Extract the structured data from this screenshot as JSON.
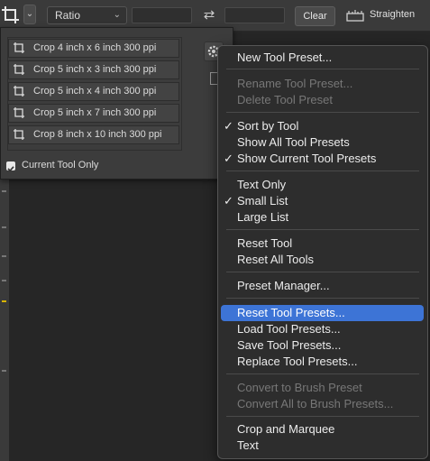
{
  "options_bar": {
    "ratio_value": "Ratio",
    "clear_label": "Clear",
    "straighten_label": "Straighten",
    "icons": [
      "crop-icon",
      "chevron-down-icon",
      "swap-icon",
      "straighten-icon"
    ]
  },
  "presets_panel": {
    "items": [
      {
        "label": "Crop 4 inch x 6 inch 300 ppi"
      },
      {
        "label": "Crop 5 inch x 3 inch 300 ppi"
      },
      {
        "label": "Crop 5 inch x 4 inch 300 ppi"
      },
      {
        "label": "Crop 5 inch x 7 inch 300 ppi"
      },
      {
        "label": "Crop 8 inch x 10 inch 300 ppi"
      }
    ],
    "current_tool_only_label": "Current Tool Only",
    "current_tool_only_checked": true
  },
  "menu": {
    "items": [
      {
        "label": "New Tool Preset...",
        "enabled": true,
        "checked": false
      },
      {
        "label": "Rename Tool Preset...",
        "enabled": false,
        "checked": false
      },
      {
        "label": "Delete Tool Preset",
        "enabled": false,
        "checked": false
      },
      {
        "label": "Sort by Tool",
        "enabled": true,
        "checked": true
      },
      {
        "label": "Show All Tool Presets",
        "enabled": true,
        "checked": false
      },
      {
        "label": "Show Current Tool Presets",
        "enabled": true,
        "checked": true
      },
      {
        "label": "Text Only",
        "enabled": true,
        "checked": false
      },
      {
        "label": "Small List",
        "enabled": true,
        "checked": true
      },
      {
        "label": "Large List",
        "enabled": true,
        "checked": false
      },
      {
        "label": "Reset Tool",
        "enabled": true,
        "checked": false
      },
      {
        "label": "Reset All Tools",
        "enabled": true,
        "checked": false
      },
      {
        "label": "Preset Manager...",
        "enabled": true,
        "checked": false
      },
      {
        "label": "Reset Tool Presets...",
        "enabled": true,
        "checked": false,
        "highlighted": true
      },
      {
        "label": "Load Tool Presets...",
        "enabled": true,
        "checked": false
      },
      {
        "label": "Save Tool Presets...",
        "enabled": true,
        "checked": false
      },
      {
        "label": "Replace Tool Presets...",
        "enabled": true,
        "checked": false
      },
      {
        "label": "Convert to Brush Preset",
        "enabled": false,
        "checked": false
      },
      {
        "label": "Convert All to Brush Presets...",
        "enabled": false,
        "checked": false
      },
      {
        "label": "Crop and Marquee",
        "enabled": true,
        "checked": false
      },
      {
        "label": "Text",
        "enabled": true,
        "checked": false
      }
    ],
    "check_glyph": "✓",
    "highlight_color": "#3d74d6"
  }
}
